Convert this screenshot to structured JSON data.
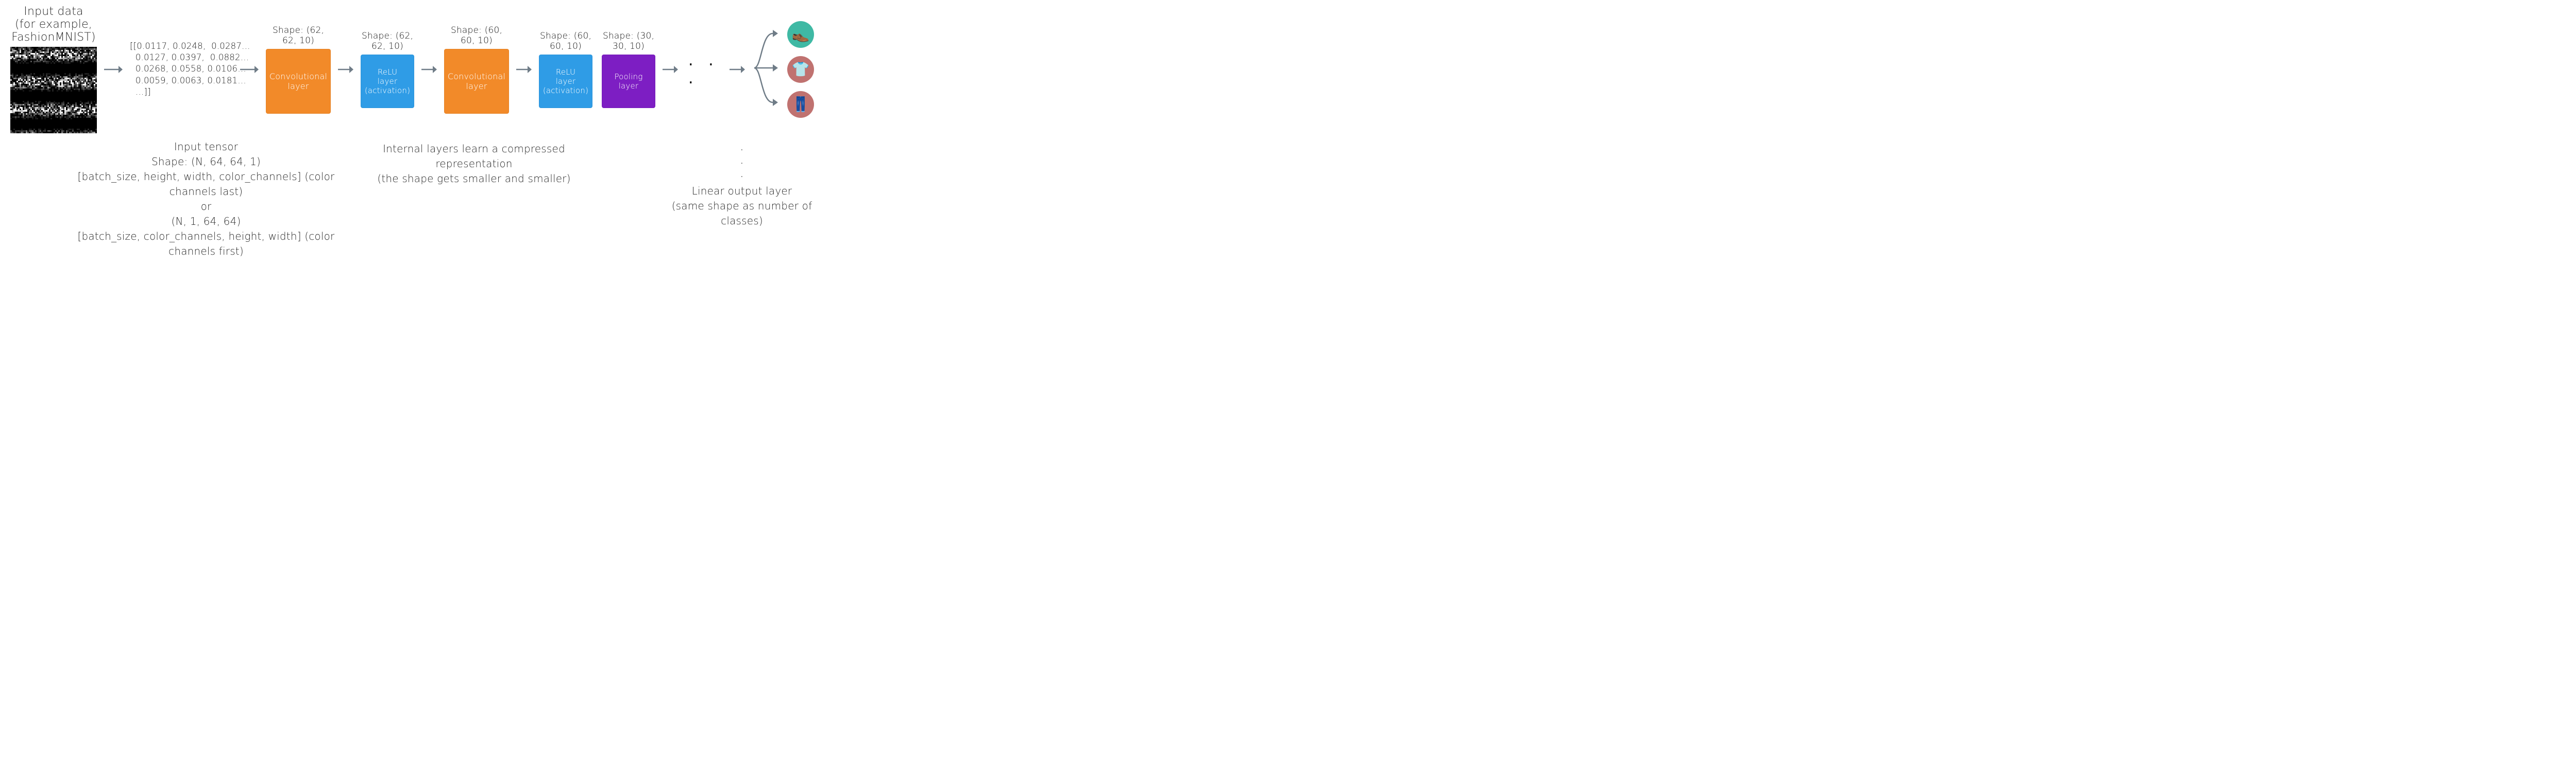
{
  "input": {
    "title_line1": "Input data",
    "title_line2": "(for example, FashionMNIST)"
  },
  "tensor_values": "[[0.0117, 0.0248,  0.0287…\n  0.0127, 0.0397,  0.0882…\n  0.0268, 0.0558, 0.0106…\n  0.0059, 0.0063, 0.0181…\n  …]]",
  "layers": [
    {
      "shape": "Shape: (62, 62, 10)",
      "label": "Convolutional layer",
      "kind": "orange"
    },
    {
      "shape": "Shape: (62, 62, 10)",
      "label": "ReLU\nlayer\n(activation)",
      "kind": "blue"
    },
    {
      "shape": "Shape: (60, 60, 10)",
      "label": "Convolutional layer",
      "kind": "orange"
    },
    {
      "shape": "Shape: (60, 60, 10)",
      "label": "ReLU\nlayer\n(activation)",
      "kind": "blue"
    },
    {
      "shape": "Shape: (30, 30, 10)",
      "label": "Pooling\nlayer",
      "kind": "purple"
    }
  ],
  "ellipsis": ". . .",
  "output_classes": {
    "items": [
      {
        "emoji": "👞",
        "color": "teal",
        "name": "class-shoe-icon"
      },
      {
        "emoji": "👕",
        "color": "rose",
        "name": "class-shirt-icon"
      },
      {
        "emoji": "👖",
        "color": "rose",
        "name": "class-pants-icon"
      }
    ]
  },
  "captions": {
    "input_tensor": {
      "line1": "Input tensor",
      "line2": "Shape: (N, 64, 64, 1)",
      "line3": "[batch_size, height, width, color_channels]  (color channels last)",
      "line4": "or",
      "line5": "(N, 1, 64, 64)",
      "line6": "[batch_size, color_channels, height, width] (color channels first)"
    },
    "internal": {
      "line1": "Internal layers learn a compressed representation",
      "line2": "(the shape gets smaller and smaller)"
    },
    "output": {
      "line1": "Linear output layer",
      "line2": "(same shape as number of classes)"
    }
  },
  "icons": {
    "arrow": "arrow-right-icon",
    "fan": "fan-out-arrow-icon"
  }
}
